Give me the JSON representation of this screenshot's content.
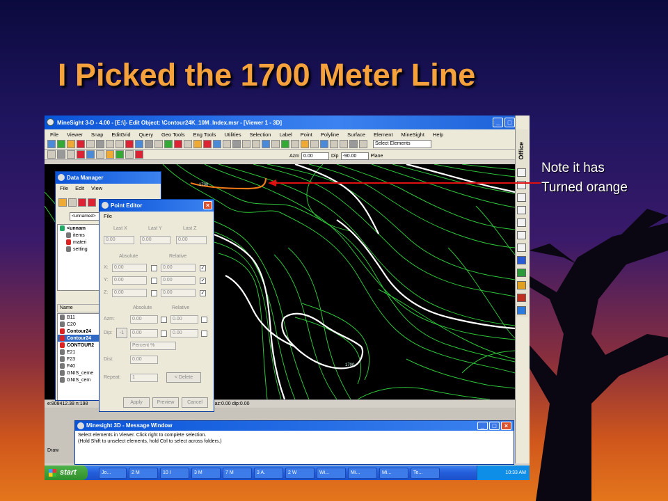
{
  "slide": {
    "title": "I Picked the 1700 Meter Line",
    "callout_line1": "Note it has",
    "callout_line2": "Turned orange"
  },
  "app": {
    "title": "MineSight 3-D  - 4.00 - [E:\\]- Edit Object: \\Contour24K_10M_Index.msr - [Viewer 1 - 3D]",
    "menu": [
      "File",
      "Viewer",
      "Snap",
      "EditGrid",
      "Query",
      "Geo Tools",
      "Eng Tools",
      "Utilities",
      "Selection",
      "Label",
      "Point",
      "Polyline",
      "Surface",
      "Element",
      "MineSight",
      "Help"
    ],
    "select_elements": "Select Elements",
    "azm_label": "Azm",
    "azm_value": "0.00",
    "dip_label": "Dip",
    "dip_value": "-90.00",
    "plane_label": "Plane",
    "status_left": "e:808412.38  n:198",
    "status_right": "00  3d:0.00  ANGLE  az:0.00  dip:0.00",
    "office_label": "Office",
    "contour_label_1": "1700",
    "contour_label_2": "1700"
  },
  "data_manager": {
    "title": "Data Manager",
    "menu": [
      "File",
      "Edit",
      "View"
    ],
    "path": "<unnamed>",
    "tree": [
      "<unnam",
      "items",
      "materi",
      "setting"
    ],
    "list_header": "Name",
    "items": [
      {
        "label": "B11",
        "color": "grey",
        "selected": false
      },
      {
        "label": "C20",
        "color": "grey",
        "selected": false
      },
      {
        "label": "Contour24",
        "color": "red",
        "selected": false
      },
      {
        "label": "Contour24",
        "color": "red",
        "selected": true
      },
      {
        "label": "CONTOUR2",
        "color": "red",
        "selected": false
      },
      {
        "label": "E21",
        "color": "grey",
        "selected": false
      },
      {
        "label": "F23",
        "color": "grey",
        "selected": false
      },
      {
        "label": "F40",
        "color": "grey",
        "selected": false
      },
      {
        "label": "GNIS_ceme",
        "color": "grey",
        "selected": false
      },
      {
        "label": "GNIS_cem",
        "color": "grey",
        "selected": false
      }
    ]
  },
  "point_editor": {
    "title": "Point Editor",
    "menu": "File",
    "last_x": "Last X",
    "last_y": "Last Y",
    "last_z": "Last Z",
    "last_x_val": "0.00",
    "last_y_val": "0.00",
    "last_z_val": "0.00",
    "absolute": "Absolute",
    "relative": "Relative",
    "x_label": "X:",
    "y_label": "Y:",
    "z_label": "Z:",
    "x_abs": "0.00",
    "y_abs": "0.00",
    "z_abs": "0.00",
    "x_rel": "0.00",
    "y_rel": "0.00",
    "z_rel": "0.00",
    "absolute2": "Absolute",
    "relative2": "Relative",
    "azm_label": "Azm:",
    "azm_abs": "0.00",
    "azm_rel": "0.00",
    "dip_label": "Dip:",
    "dip_sign": "-1",
    "dip_abs": "0.00",
    "dip_rel": "0.00",
    "percent": "Percent %",
    "dist_label": "Dist:",
    "dist_val": "0.00",
    "repeat_label": "Repeat:",
    "repeat_val": "1",
    "delete_btn": "< Delete",
    "apply": "Apply",
    "preview": "Preview",
    "cancel": "Cancel"
  },
  "message_window": {
    "title": "Minesight 3D - Message Window",
    "line1": "Select elements in Viewer. Click right to complete selection.",
    "line2": "(Hold Shift to unselect elements, hold Ctrl to select across folders.)"
  },
  "lower_panel": {
    "draw_label": "Draw"
  },
  "taskbar": {
    "start": "start",
    "tasks": [
      "Jo...",
      "2 M",
      "10 I",
      "3 M",
      "7 M",
      "3 A.",
      "2 W",
      "Wi...",
      "Mi...",
      "Mi...",
      "Te..."
    ],
    "clock": "10:33 AM"
  },
  "colors": {
    "contour_green": "#2fc43a",
    "contour_white": "#ffffff",
    "selected_orange": "#f07a18",
    "arrow_red": "#e01010",
    "title_orange": "#f6a23c"
  }
}
